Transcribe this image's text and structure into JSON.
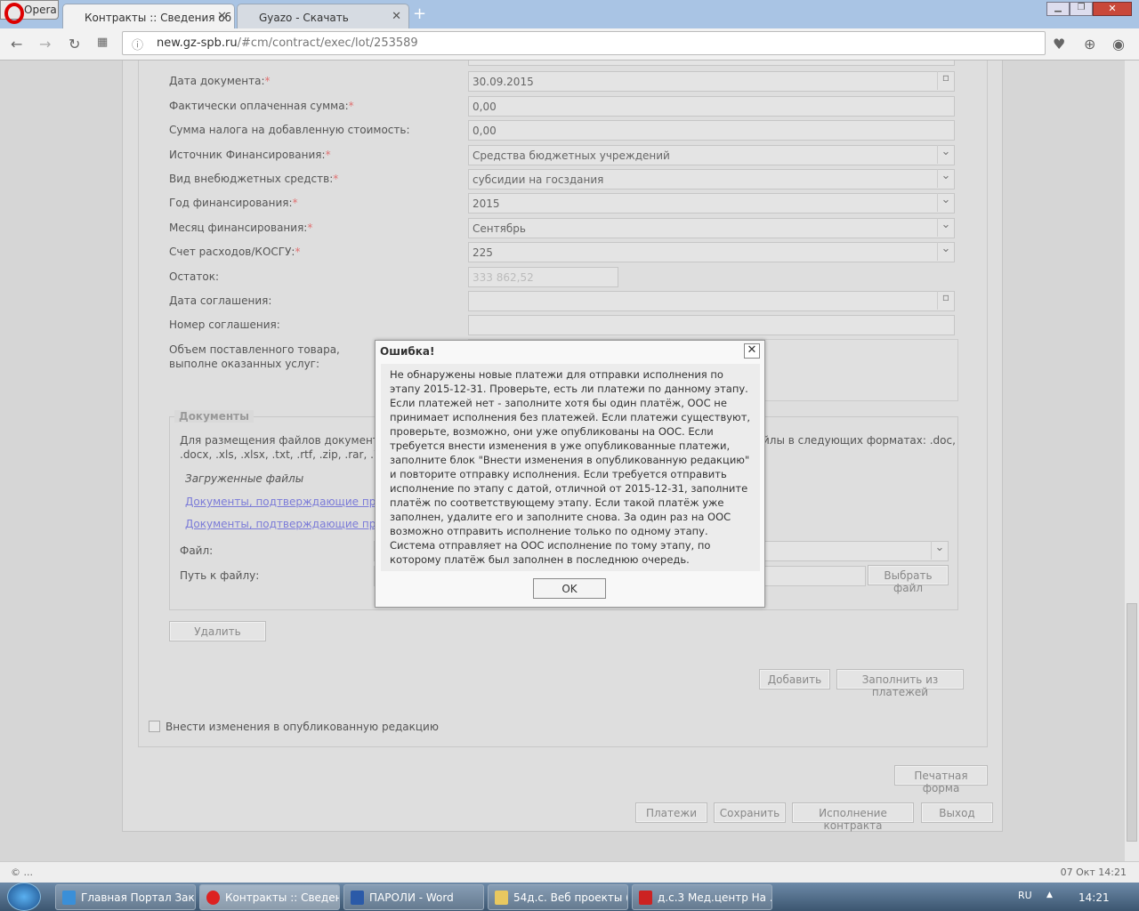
{
  "browser": {
    "opera_label": "Opera",
    "tabs": [
      {
        "label": "Контракты :: Сведения об",
        "active": true
      },
      {
        "label": "Gyazo - Скачать",
        "active": false
      }
    ],
    "url_domain": "new.gz-spb.ru",
    "url_path": "/#cm/contract/exec/lot/253589"
  },
  "form": {
    "fields": [
      {
        "label": "Дата документа:",
        "required": true,
        "value": "30.09.2015",
        "type": "date"
      },
      {
        "label": "Фактически оплаченная сумма:",
        "required": true,
        "value": "0,00",
        "type": "text"
      },
      {
        "label": "Сумма налога на добавленную стоимость:",
        "required": false,
        "value": "0,00",
        "type": "text"
      },
      {
        "label": "Источник Финансирования:",
        "required": true,
        "value": "Средства бюджетных учреждений",
        "type": "select"
      },
      {
        "label": "Вид внебюджетных средств:",
        "required": true,
        "value": "субсидии на госздания",
        "type": "select"
      },
      {
        "label": "Год финансирования:",
        "required": true,
        "value": "2015",
        "type": "select"
      },
      {
        "label": "Месяц финансирования:",
        "required": true,
        "value": "Сентябрь",
        "type": "select"
      },
      {
        "label": "Счет расходов/КОСГУ:",
        "required": true,
        "value": "225",
        "type": "select"
      },
      {
        "label": "Остаток:",
        "required": false,
        "value": "333 862,52",
        "type": "readonly"
      },
      {
        "label": "Дата соглашения:",
        "required": false,
        "value": "",
        "type": "date"
      },
      {
        "label": "Номер соглашения:",
        "required": false,
        "value": "",
        "type": "text"
      }
    ],
    "volume_label": "Объем поставленного товара, выполне оказанных услуг:",
    "documents": {
      "legend": "Документы",
      "info": "Для размещения файлов документа",
      "info_right": "йлы в следующих форматах: .doc,",
      "formats": ".docx, .xls, .xlsx, .txt, .rtf, .zip, .rar, .7",
      "uploaded_label": "Загруженные файлы",
      "links": [
        "Документы, подтверждающие прие",
        "Документы, подтверждающие прие"
      ],
      "file_label": "Файл:",
      "path_label": "Путь к файлу:",
      "choose_file": "Выбрать файл"
    },
    "delete_btn": "Удалить",
    "add_btn": "Добавить",
    "fill_btn": "Заполнить из платежей",
    "checkbox_label": "Внести изменения в опубликованную редакцию",
    "print_btn": "Печатная форма",
    "bottom_buttons": [
      "Платежи",
      "Сохранить",
      "Исполнение контракта",
      "Выход"
    ]
  },
  "dialog": {
    "title": "Ошибка!",
    "message": "Не обнаружены новые платежи для отправки исполнения по этапу 2015-12-31. Проверьте, есть ли платежи по данному этапу. Если платежей нет - заполните хотя бы один платёж, ООС не принимает исполнения без платежей. Если платежи существуют, проверьте, возможно, они уже опубликованы на ООС. Если требуется внести изменения в уже опубликованные платежи, заполните блок \"Внести изменения в опубликованную редакцию\" и повторите отправку исполнения. Если требуется отправить исполнение по этапу с датой, отличной от 2015-12-31, заполните платёж по соответствующему этапу. Если такой платёж уже заполнен, удалите его и заполните снова. За один раз на ООС возможно отправить исполнение только по одному этапу. Система отправляет на ООС исполнение по тому этапу, по которому платёж был заполнен в последнюю очередь.",
    "ok": "OK"
  },
  "status": {
    "left": "© ...",
    "right": "07 Окт 14:21"
  },
  "taskbar": {
    "items": [
      "Главная Портал Зак...",
      "Контракты :: Сведен...",
      "ПАРОЛИ - Word",
      "54д.с. Веб проекты (...",
      "д.с.3 Мед.центр На ..."
    ],
    "lang": "RU",
    "clock": "14:21"
  }
}
